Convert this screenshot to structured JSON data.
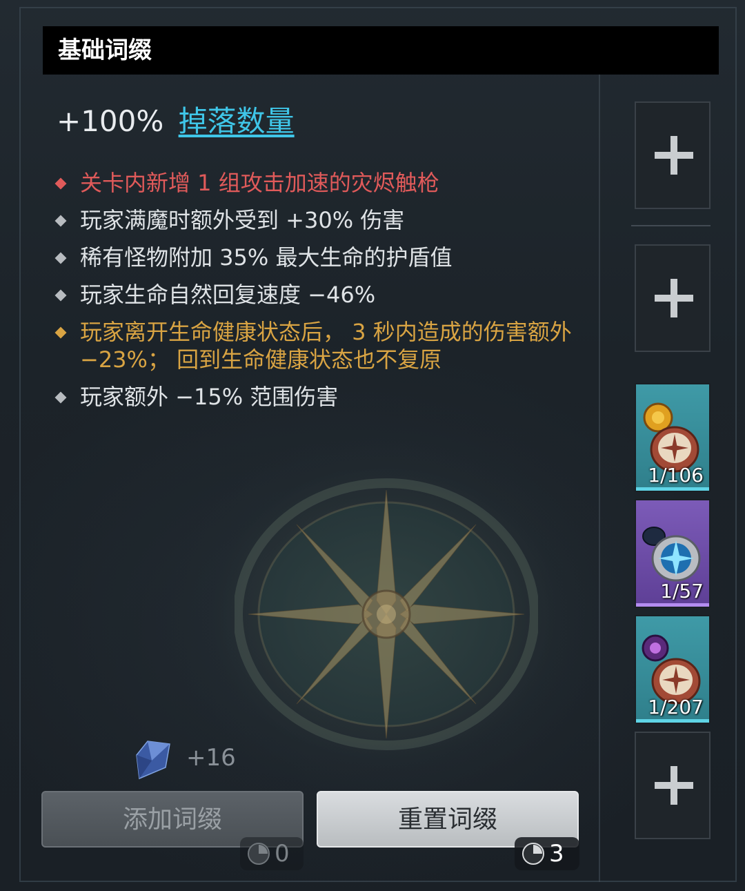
{
  "header": {
    "title": "基础词缀"
  },
  "main_affix": {
    "value": "+100%",
    "name": "掉落数量"
  },
  "affixes": [
    {
      "text": "关卡内新增 1 组攻击加速的灾烬触枪",
      "color": "#e05a5a"
    },
    {
      "text": "玩家满魔时额外受到 +30% 伤害",
      "color": "#dfe3e6"
    },
    {
      "text": "稀有怪物附加 35% 最大生命的护盾值",
      "color": "#dfe3e6"
    },
    {
      "text": "玩家生命自然回复速度 −46%",
      "color": "#dfe3e6"
    },
    {
      "text": "玩家离开生命健康状态后， 3 秒内造成的伤害额外 −23%； 回到生命健康状态也不复原",
      "color": "#d9a443"
    },
    {
      "text": "玩家额外 −15% 范围伤害",
      "color": "#dfe3e6"
    }
  ],
  "crystal": {
    "icon": "crystal-icon",
    "count": "+16"
  },
  "buttons": {
    "add_label": "添加词缀",
    "reset_label": "重置词缀"
  },
  "costs": {
    "add": "0",
    "reset": "3"
  },
  "slots": [
    {
      "type": "empty"
    },
    {
      "type": "empty"
    },
    {
      "type": "item",
      "count": "1/106",
      "color": "#3f9aa7"
    },
    {
      "type": "item",
      "count": "1/57",
      "color": "#7c5bb8"
    },
    {
      "type": "item",
      "count": "1/207",
      "color": "#3f9aa7"
    },
    {
      "type": "empty"
    }
  ]
}
